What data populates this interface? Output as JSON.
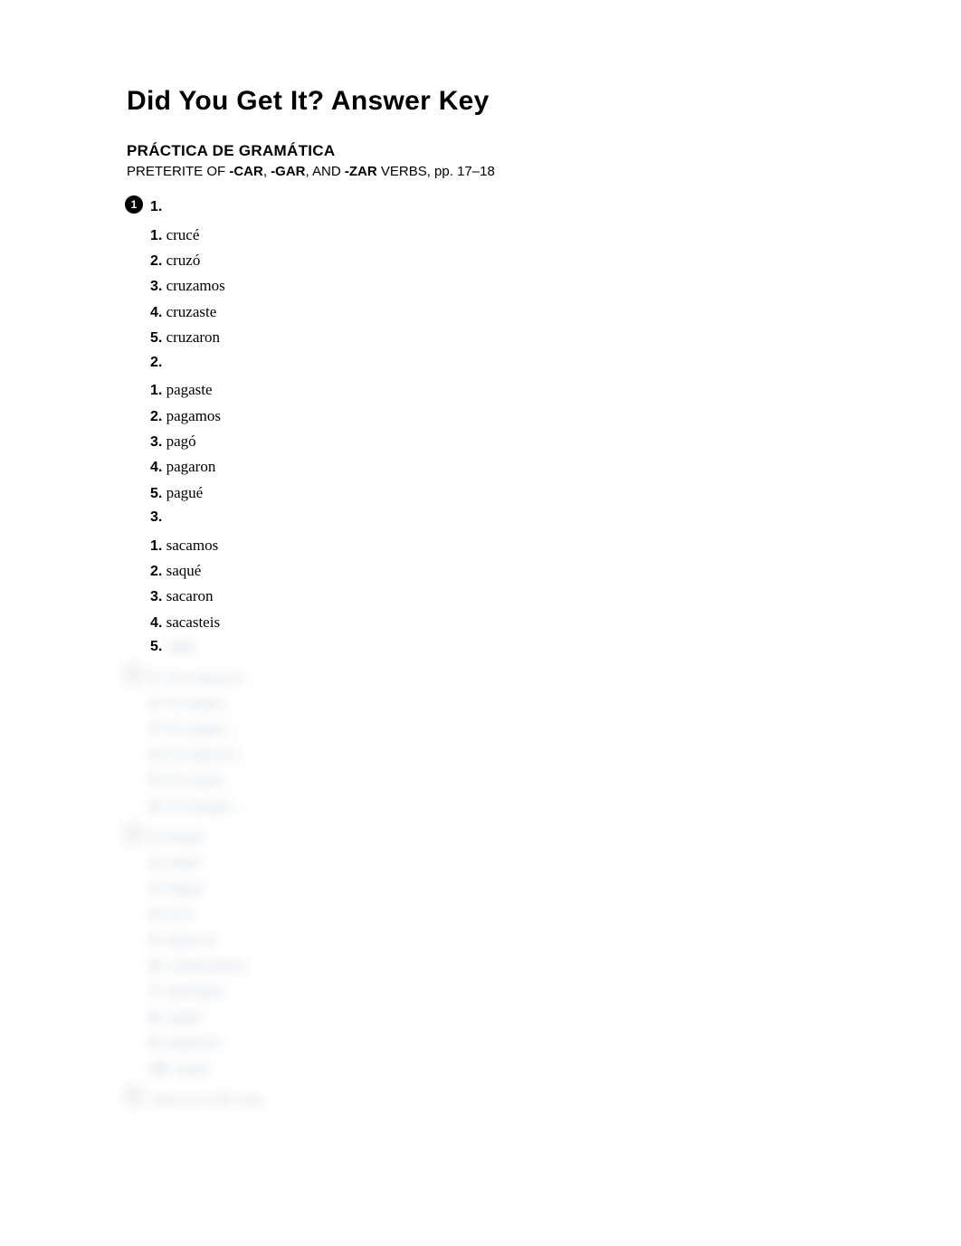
{
  "title": "Did You Get It? Answer Key",
  "section": {
    "heading": "PRÁCTICA DE GRAMÁTICA",
    "desc_prefix": "PRETERITE OF ",
    "bold1": "-CAR",
    "sep1": ", ",
    "bold2": "-GAR",
    "sep2": ", AND ",
    "bold3": "-ZAR",
    "desc_suffix": " VERBS, pp. 17–18"
  },
  "exercise1": {
    "badge": "1",
    "groups": [
      {
        "header": "1.",
        "items": [
          {
            "n": "1.",
            "a": "crucé"
          },
          {
            "n": "2.",
            "a": "cruzó"
          },
          {
            "n": "3.",
            "a": "cruzamos"
          },
          {
            "n": "4.",
            "a": "cruzaste"
          },
          {
            "n": "5.",
            "a": "cruzaron"
          }
        ]
      },
      {
        "header": "2.",
        "items": [
          {
            "n": "1.",
            "a": "pagaste"
          },
          {
            "n": "2.",
            "a": "pagamos"
          },
          {
            "n": "3.",
            "a": "pagó"
          },
          {
            "n": "4.",
            "a": "pagaron"
          },
          {
            "n": "5.",
            "a": "pagué"
          }
        ]
      },
      {
        "header": "3.",
        "items": [
          {
            "n": "1.",
            "a": "sacamos"
          },
          {
            "n": "2.",
            "a": "saqué"
          },
          {
            "n": "3.",
            "a": "sacaron"
          },
          {
            "n": "4.",
            "a": "sacasteis"
          }
        ],
        "last_num": "5.",
        "last_blurred": "sacó"
      }
    ]
  },
  "blurred_exercise2": {
    "badge": "2",
    "items": [
      {
        "n": "1.",
        "a": "Yo comencé..."
      },
      {
        "n": "2.",
        "a": "Yo saqué..."
      },
      {
        "n": "3.",
        "a": "Yo pagué..."
      },
      {
        "n": "4.",
        "a": "Yo almorcé..."
      },
      {
        "n": "5.",
        "a": "Yo toqué..."
      },
      {
        "n": "6.",
        "a": "Yo busqué..."
      }
    ]
  },
  "blurred_exercise3": {
    "badge": "3",
    "items": [
      {
        "n": "1.",
        "a": "llegué"
      },
      {
        "n": "2.",
        "a": "saqué"
      },
      {
        "n": "3.",
        "a": "Pagué"
      },
      {
        "n": "4.",
        "a": "tocó"
      },
      {
        "n": "5.",
        "a": "almorcé"
      },
      {
        "n": "6.",
        "a": "comenzamos"
      },
      {
        "n": "7.",
        "a": "practiqué"
      },
      {
        "n": "8.",
        "a": "saqué"
      },
      {
        "n": "9.",
        "a": "pagamos"
      },
      {
        "n": "10.",
        "a": "saqué"
      }
    ]
  },
  "blurred_exercise4": {
    "badge": "4",
    "line": "Answers will vary."
  }
}
